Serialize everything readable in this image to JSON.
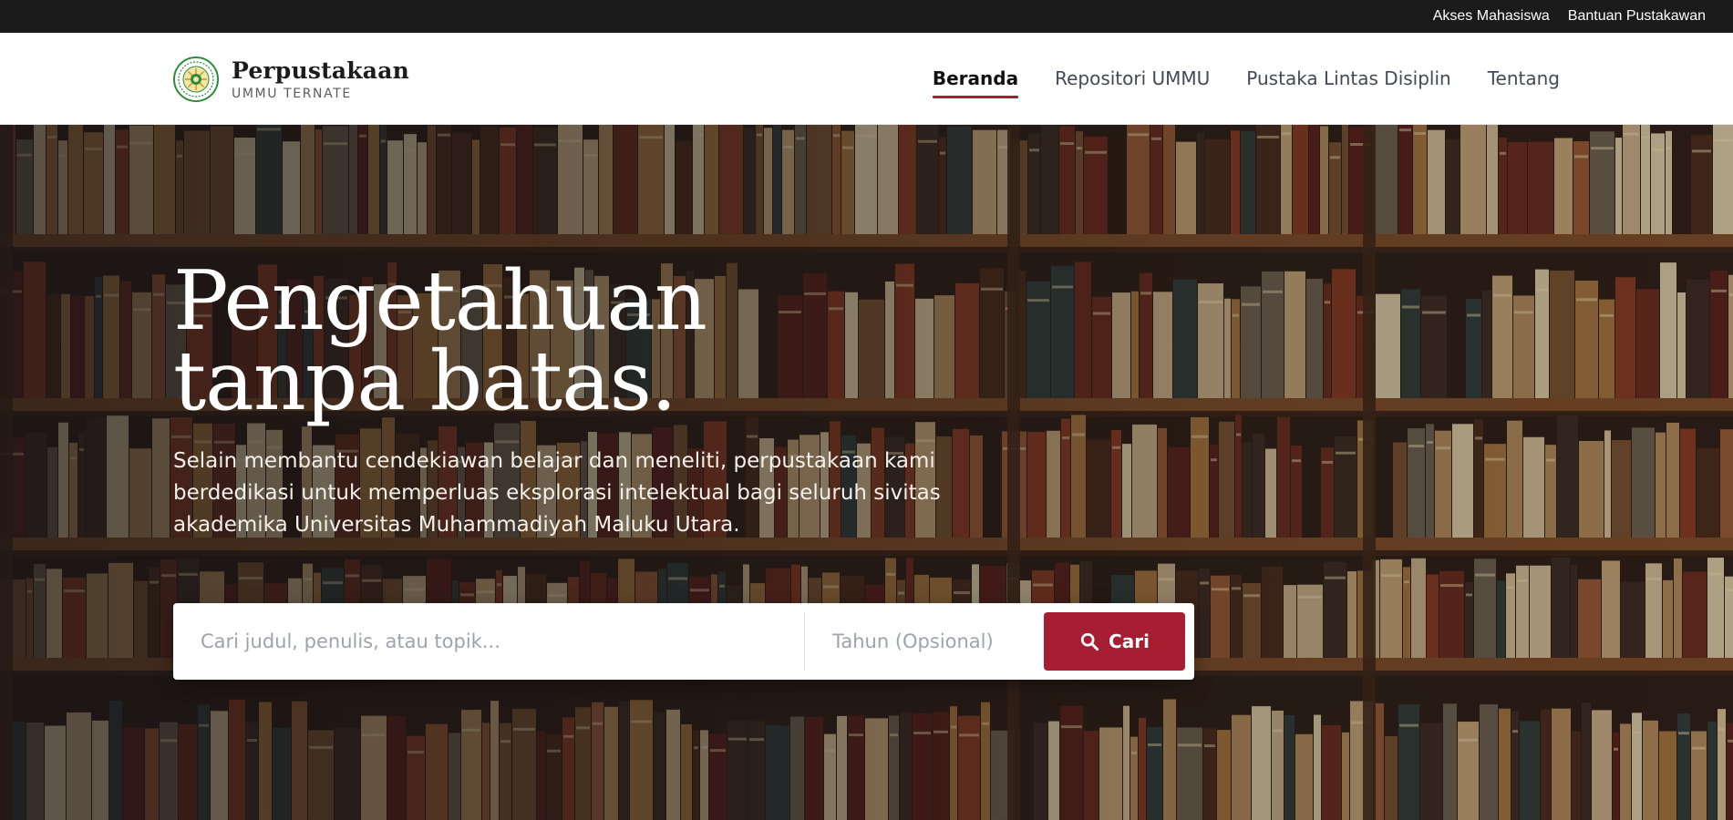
{
  "utility_bar": {
    "links": [
      "Akses Mahasiswa",
      "Bantuan Pustakawan"
    ]
  },
  "brand": {
    "title": "Perpustakaan",
    "subtitle": "UMMU TERNATE",
    "logo_icon": "university-seal-icon"
  },
  "nav": {
    "items": [
      {
        "label": "Beranda",
        "active": true
      },
      {
        "label": "Repositori UMMU",
        "active": false
      },
      {
        "label": "Pustaka Lintas Disiplin",
        "active": false
      },
      {
        "label": "Tentang",
        "active": false
      }
    ]
  },
  "hero": {
    "headline_line1": "Pengetahuan",
    "headline_line2": "tanpa batas.",
    "description": "Selain membantu cendekiawan belajar dan meneliti, perpustakaan kami berdedikasi untuk memperluas eksplorasi intelektual bagi seluruh sivitas akademika Universitas Muhammadiyah Maluku Utara.",
    "background": "bookshelf-photo"
  },
  "search": {
    "query_placeholder": "Cari judul, penulis, atau topik...",
    "query_value": "",
    "year_placeholder": "Tahun (Opsional)",
    "year_value": "",
    "button_label": "Cari",
    "button_icon": "search-icon"
  },
  "colors": {
    "accent": "#a71d31",
    "topbar": "#1b1b1b",
    "header_bg": "#ffffff"
  }
}
